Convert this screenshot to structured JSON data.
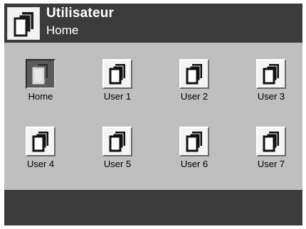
{
  "header": {
    "title": "Utilisateur",
    "subtitle": "Home",
    "icon": "user-profiles-icon"
  },
  "users": [
    {
      "label": "Home",
      "selected": true
    },
    {
      "label": "User 1",
      "selected": false
    },
    {
      "label": "User 2",
      "selected": false
    },
    {
      "label": "User 3",
      "selected": false
    },
    {
      "label": "User 4",
      "selected": false
    },
    {
      "label": "User 5",
      "selected": false
    },
    {
      "label": "User 6",
      "selected": false
    },
    {
      "label": "User 7",
      "selected": false
    }
  ],
  "colors": {
    "header_bg": "#3b3b3b",
    "panel_bg": "#bfbfbf",
    "selected_bg": "#5a5a5a"
  }
}
